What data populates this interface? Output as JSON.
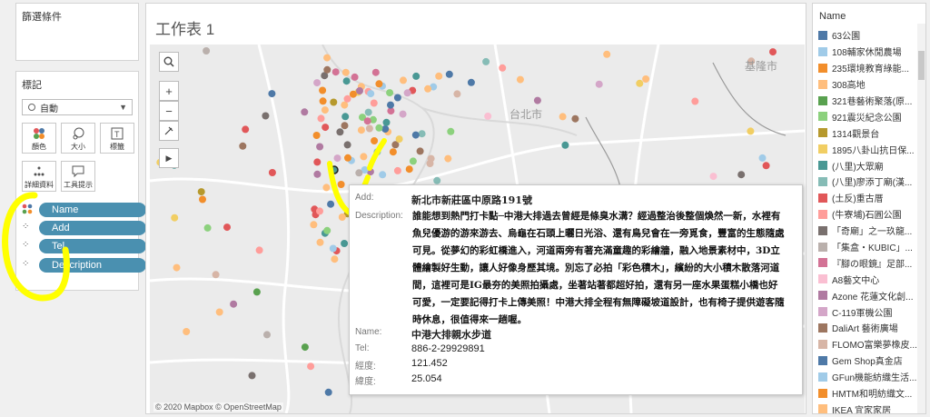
{
  "filters": {
    "title": "篩選條件"
  },
  "marks": {
    "title": "標記",
    "mark_type": "自動",
    "cards": [
      "顏色",
      "大小",
      "標籤",
      "詳細資料",
      "工具提示"
    ],
    "fields": [
      "Name",
      "Add",
      "Tel",
      "Description"
    ]
  },
  "sheet": {
    "title": "工作表 1"
  },
  "map": {
    "attribution": "© 2020 Mapbox © OpenStreetMap",
    "labels": [
      "台北市",
      "基隆市"
    ],
    "accent": "#4a90b0"
  },
  "tooltip": {
    "add_label": "Add:",
    "add_value": "新北市新莊區中原路191號",
    "desc_label": "Description:",
    "desc_value": "誰能想到熱門打卡點─中港大排過去曾經是條臭水溝？經過整治後整個煥然一新，水裡有魚兒優游的游來游去、烏龜在石頭上曬日光浴、還有鳥兒會在一旁覓食，豐富的生態隨處可見。從夢幻的彩虹橋進入，河道兩旁有著充滿童趣的彩繪牆，融入地景素材中，3D立體繪製好生動，讓人好像身歷其境。別忘了必拍「彩色積木」，繽紛的大小積木散落河道間，這裡可是IG最夯的美照拍攝處，坐著站著都超好拍，還有另一座水果蛋糕小橋也好可愛，一定要記得打卡上傳美照！中港大排全程有無障礙坡道設計，也有椅子提供遊客隨時休息，很值得來一趟喔。",
    "name_label": "Name:",
    "name_value": "中港大排親水步道",
    "tel_label": "Tel:",
    "tel_value": "886-2-29929891",
    "lon_label": "經度:",
    "lon_value": "121.452",
    "lat_label": "緯度:",
    "lat_value": "25.054"
  },
  "legend": {
    "title": "Name",
    "items": [
      {
        "label": "63公園",
        "color": "#4e79a7"
      },
      {
        "label": "108輔家休閒農場",
        "color": "#a0cbe8"
      },
      {
        "label": "235環境教育綠能...",
        "color": "#f28e2b"
      },
      {
        "label": "308高地",
        "color": "#ffbe7d"
      },
      {
        "label": "321巷藝術聚落(原...",
        "color": "#59a14f"
      },
      {
        "label": "921震災紀念公園",
        "color": "#8cd17d"
      },
      {
        "label": "1314觀景台",
        "color": "#b6992d"
      },
      {
        "label": "1895八卦山抗日保...",
        "color": "#f1ce63"
      },
      {
        "label": "(八里)大眾廟",
        "color": "#499894"
      },
      {
        "label": "(八里)廖添丁廟(漢...",
        "color": "#86bcb6"
      },
      {
        "label": "(土反)重古厝",
        "color": "#e15759"
      },
      {
        "label": "(牛寮埔)石圓公園",
        "color": "#ff9d9a"
      },
      {
        "label": "「奇廟」之一玖龍...",
        "color": "#79706e"
      },
      {
        "label": "「集盒・KUBIC」...",
        "color": "#bab0ac"
      },
      {
        "label": "『腳の眼鏡』足部...",
        "color": "#d37295"
      },
      {
        "label": "A8藝文中心",
        "color": "#fabfd2"
      },
      {
        "label": "Azone 花蓮文化創...",
        "color": "#b07aa1"
      },
      {
        "label": "C-119軍機公園",
        "color": "#d4a6c8"
      },
      {
        "label": "DaliArt 藝術廣場",
        "color": "#9d7660"
      },
      {
        "label": "FLOMO富樂夢橡皮...",
        "color": "#d7b5a6"
      },
      {
        "label": "Gem Shop真金店",
        "color": "#4e79a7"
      },
      {
        "label": "GFun機能紡織生活...",
        "color": "#a0cbe8"
      },
      {
        "label": "HMTM和明紡織文...",
        "color": "#f28e2b"
      },
      {
        "label": "IKEA 宜家家居",
        "color": "#ffbe7d"
      }
    ]
  }
}
